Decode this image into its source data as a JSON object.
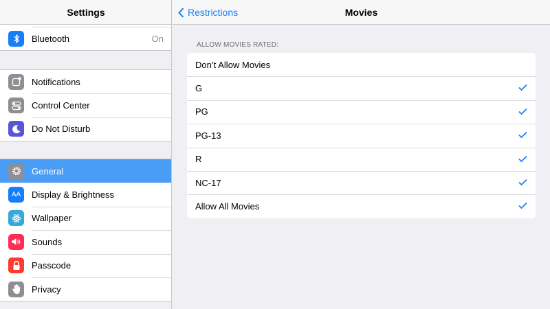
{
  "sidebar": {
    "title": "Settings",
    "groups": [
      {
        "items": [
          {
            "label": "Bluetooth",
            "value": "On",
            "icon": "bluetooth-icon",
            "color": "#157efb"
          }
        ]
      },
      {
        "items": [
          {
            "label": "Notifications",
            "icon": "notifications-icon",
            "color": "#8e8e93"
          },
          {
            "label": "Control Center",
            "icon": "control-center-icon",
            "color": "#8e8e93"
          },
          {
            "label": "Do Not Disturb",
            "icon": "moon-icon",
            "color": "#5856d6"
          }
        ]
      },
      {
        "items": [
          {
            "label": "General",
            "icon": "gear-icon",
            "color": "#8e8e93",
            "selected": true
          },
          {
            "label": "Display & Brightness",
            "icon": "display-icon",
            "color": "#157efb"
          },
          {
            "label": "Wallpaper",
            "icon": "wallpaper-icon",
            "color": "#34aadc"
          },
          {
            "label": "Sounds",
            "icon": "speaker-icon",
            "color": "#ff2d55"
          },
          {
            "label": "Passcode",
            "icon": "lock-icon",
            "color": "#ff3b30"
          },
          {
            "label": "Privacy",
            "icon": "hand-icon",
            "color": "#8e8e93"
          }
        ]
      }
    ],
    "display_icon_text": "AA"
  },
  "detail": {
    "back_label": "Restrictions",
    "title": "Movies",
    "section_header": "ALLOW MOVIES RATED:",
    "options": [
      {
        "label": "Don’t Allow Movies",
        "checked": false
      },
      {
        "label": "G",
        "checked": true
      },
      {
        "label": "PG",
        "checked": true
      },
      {
        "label": "PG-13",
        "checked": true
      },
      {
        "label": "R",
        "checked": true
      },
      {
        "label": "NC-17",
        "checked": true
      },
      {
        "label": "Allow All Movies",
        "checked": true
      }
    ]
  },
  "colors": {
    "accent": "#157efb",
    "selected_row": "#4a9df5"
  }
}
